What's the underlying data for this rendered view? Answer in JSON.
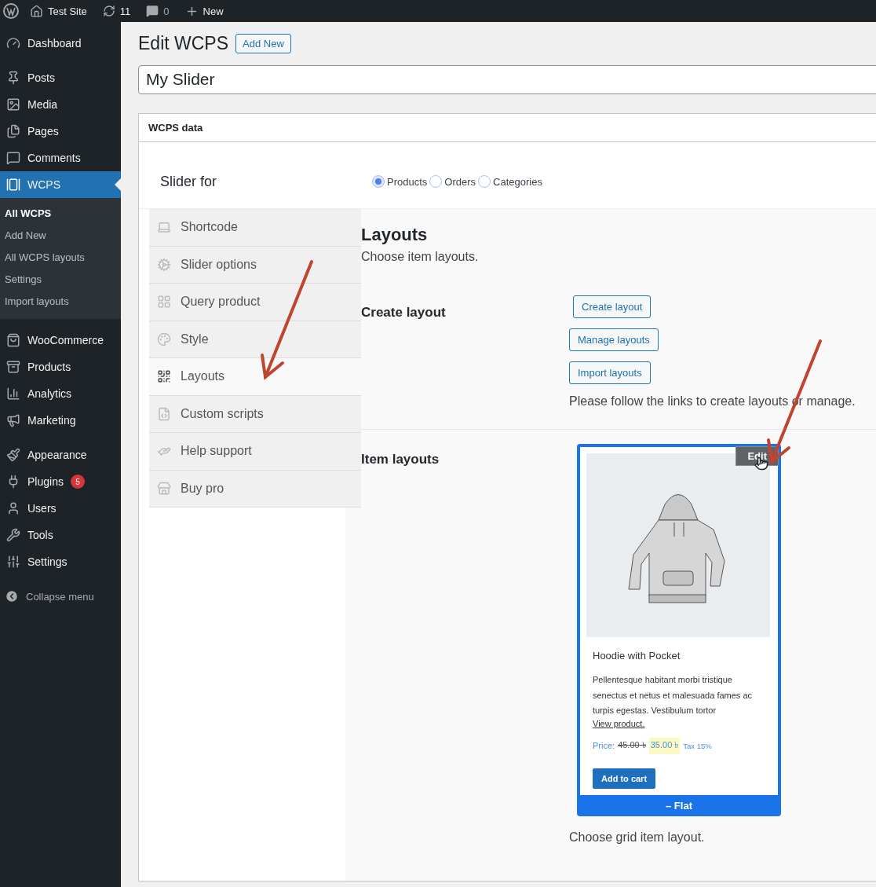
{
  "admin_bar": {
    "site": "Test Site",
    "updates": "11",
    "comments": "0",
    "new": "New"
  },
  "sidebar": {
    "groups": [
      [
        {
          "label": "Dashboard",
          "current": false
        }
      ],
      [
        {
          "label": "Posts",
          "current": false
        },
        {
          "label": "Media",
          "current": false
        },
        {
          "label": "Pages",
          "current": false
        },
        {
          "label": "Comments",
          "current": false
        },
        {
          "label": "WCPS",
          "current": true,
          "submenu": [
            {
              "label": "All WCPS",
              "selected": true
            },
            {
              "label": "Add New",
              "selected": false
            },
            {
              "label": "All WCPS layouts",
              "selected": false
            },
            {
              "label": "Settings",
              "selected": false
            },
            {
              "label": "Import layouts",
              "selected": false
            }
          ]
        }
      ],
      [
        {
          "label": "WooCommerce",
          "current": false
        },
        {
          "label": "Products",
          "current": false
        },
        {
          "label": "Analytics",
          "current": false
        },
        {
          "label": "Marketing",
          "current": false
        }
      ],
      [
        {
          "label": "Appearance",
          "current": false
        },
        {
          "label": "Plugins",
          "current": false,
          "badge": "5"
        },
        {
          "label": "Users",
          "current": false
        },
        {
          "label": "Tools",
          "current": false
        },
        {
          "label": "Settings",
          "current": false
        }
      ]
    ],
    "collapse": "Collapse menu"
  },
  "page": {
    "title": "Edit WCPS",
    "add_new": "Add New",
    "post_title": "My Slider"
  },
  "metabox": {
    "title": "WCPS data",
    "slider_for": {
      "label": "Slider for",
      "options": [
        {
          "label": "Products",
          "selected": true
        },
        {
          "label": "Orders",
          "selected": false
        },
        {
          "label": "Categories",
          "selected": false
        }
      ]
    },
    "tabs": [
      {
        "label": "Shortcode",
        "selected": false
      },
      {
        "label": "Slider options",
        "selected": false
      },
      {
        "label": "Query product",
        "selected": false
      },
      {
        "label": "Style",
        "selected": false
      },
      {
        "label": "Layouts",
        "selected": true
      },
      {
        "label": "Custom scripts",
        "selected": false
      },
      {
        "label": "Help support",
        "selected": false
      },
      {
        "label": "Buy pro",
        "selected": false
      }
    ],
    "panel": {
      "heading": "Layouts",
      "subheading": "Choose item layouts.",
      "create": {
        "label": "Create layout",
        "buttons": [
          "Create layout",
          "Manage layouts",
          "Import layouts"
        ],
        "note": "Please follow the links to create layouts or manage."
      },
      "items": {
        "label": "Item layouts",
        "card": {
          "edit": "Edit",
          "title": "Hoodie with Pocket",
          "description": "Pellentesque habitant morbi tristique senectus et netus et malesuada fames ac turpis egestas. Vestibulum tortor",
          "link": "View product.",
          "price_label": "Price:",
          "old_price": "45.00 ৳",
          "price": "35.00 ৳",
          "tax": "Tax 15%",
          "button": "Add to cart",
          "footer": "– Flat"
        },
        "note": "Choose grid item layout."
      }
    }
  }
}
